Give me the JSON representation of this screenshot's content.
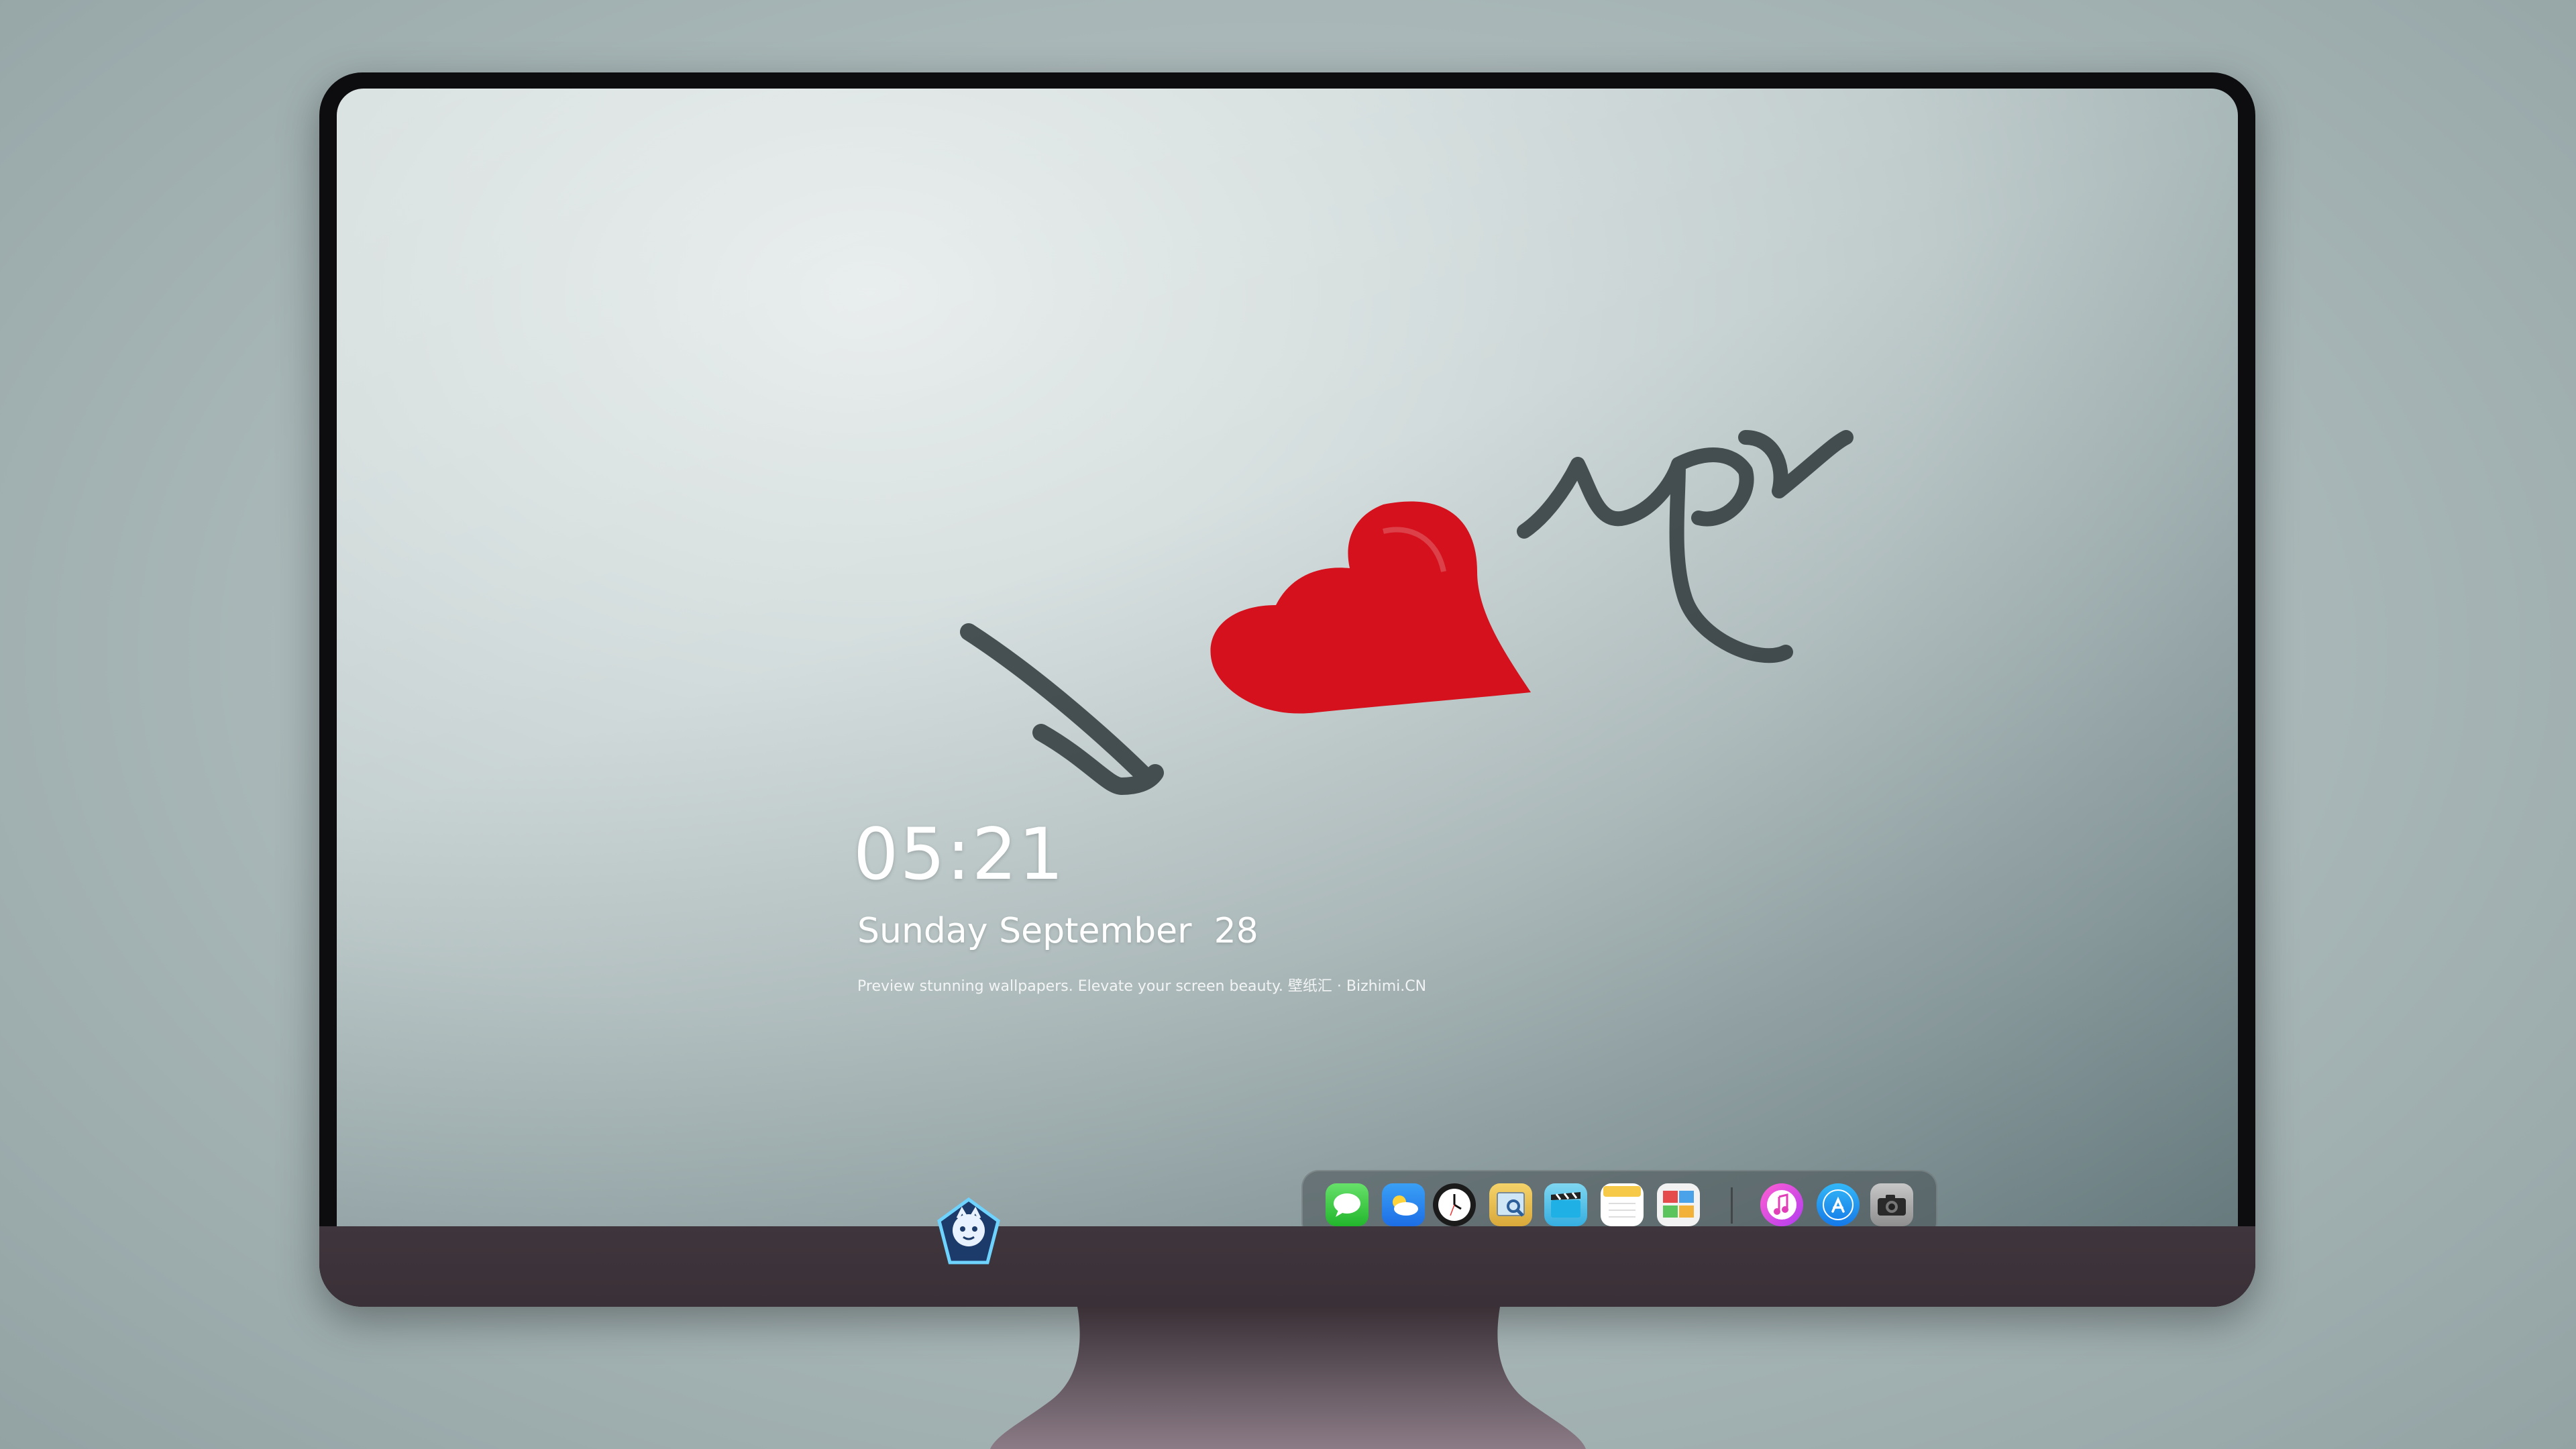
{
  "lock_screen": {
    "time": "05:21",
    "date": "Sunday September  28",
    "caption": "Preview stunning wallpapers. Elevate your screen beauty. 壁纸汇 · Bizhimi.CN"
  },
  "wallpaper": {
    "handwriting_left": "I",
    "handwriting_right": "you"
  },
  "dock": {
    "apps": [
      {
        "name": "Messages",
        "icon": "messages-icon"
      },
      {
        "name": "Weather",
        "icon": "weather-icon"
      },
      {
        "name": "Clock",
        "icon": "clock-icon"
      },
      {
        "name": "Preview",
        "icon": "preview-icon"
      },
      {
        "name": "Clips",
        "icon": "clapperboard-icon"
      },
      {
        "name": "Notes",
        "icon": "notes-icon"
      },
      {
        "name": "Photo Booth",
        "icon": "photo-gallery-icon"
      },
      {
        "name": "iTunes",
        "icon": "music-note-icon"
      },
      {
        "name": "App Store",
        "icon": "app-store-icon"
      },
      {
        "name": "Camera",
        "icon": "camera-icon"
      }
    ]
  },
  "colors": {
    "heart": "#d4111c",
    "ink": "#2e3739",
    "bezel": "#0d0d0f",
    "chin": "#3f353c"
  }
}
